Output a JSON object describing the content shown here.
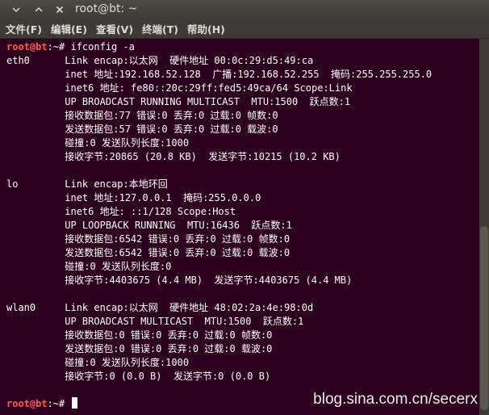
{
  "window": {
    "title": "root@bt: ~",
    "buttons": {
      "minimize": "∨",
      "maximize": "∧",
      "close": "✕"
    }
  },
  "menu": [
    "文件(F)",
    "编辑(E)",
    "查看(V)",
    "终端(T)",
    "帮助(H)"
  ],
  "prompt": {
    "user": "root@bt",
    "rest": ":~# "
  },
  "command": "ifconfig -a",
  "output": [
    "eth0      Link encap:以太网  硬件地址 00:0c:29:d5:49:ca",
    "          inet 地址:192.168.52.128  广播:192.168.52.255  掩码:255.255.255.0",
    "          inet6 地址: fe80::20c:29ff:fed5:49ca/64 Scope:Link",
    "          UP BROADCAST RUNNING MULTICAST  MTU:1500  跃点数:1",
    "          接收数据包:77 错误:0 丢弃:0 过载:0 帧数:0",
    "          发送数据包:57 错误:0 丢弃:0 过载:0 载波:0",
    "          碰撞:0 发送队列长度:1000",
    "          接收字节:20865 (20.8 KB)  发送字节:10215 (10.2 KB)",
    "",
    "lo        Link encap:本地环回",
    "          inet 地址:127.0.0.1  掩码:255.0.0.0",
    "          inet6 地址: ::1/128 Scope:Host",
    "          UP LOOPBACK RUNNING  MTU:16436  跃点数:1",
    "          接收数据包:6542 错误:0 丢弃:0 过载:0 帧数:0",
    "          发送数据包:6542 错误:0 丢弃:0 过载:0 载波:0",
    "          碰撞:0 发送队列长度:0",
    "          接收字节:4403675 (4.4 MB)  发送字节:4403675 (4.4 MB)",
    "",
    "wlan0     Link encap:以太网  硬件地址 48:02:2a:4e:98:0d",
    "          UP BROADCAST MULTICAST  MTU:1500  跃点数:1",
    "          接收数据包:0 错误:0 丢弃:0 过载:0 帧数:0",
    "          发送数据包:0 错误:0 丢弃:0 过载:0 载波:0",
    "          碰撞:0 发送队列长度:1000",
    "          接收字节:0 (0.0 B)  发送字节:0 (0.0 B)",
    ""
  ],
  "watermark": "blog.sina.com.cn/secerx",
  "colors": {
    "terminal_bg": "#2c001e",
    "prompt_user": "#ff5555",
    "chrome": "#3c3b37"
  }
}
